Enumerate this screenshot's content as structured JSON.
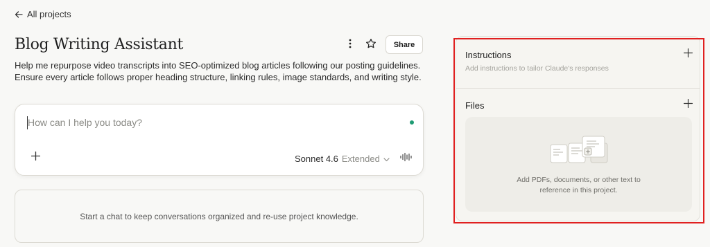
{
  "nav": {
    "back_label": "All projects"
  },
  "project": {
    "title": "Blog Writing Assistant",
    "description_line1": "Help me repurpose video transcripts into SEO-optimized blog articles following our posting guidelines.",
    "description_line2": "Ensure every article follows proper heading structure, linking rules, image standards, and writing style.",
    "share_label": "Share"
  },
  "composer": {
    "placeholder": "How can I help you today?",
    "model_name": "Sonnet 4.6",
    "model_mode": "Extended",
    "status_color": "#1e9b73"
  },
  "chats": {
    "empty_message": "Start a chat to keep conversations organized and re-use project knowledge."
  },
  "side_panel": {
    "instructions_title": "Instructions",
    "instructions_hint": "Add instructions to tailor Claude's responses",
    "files_title": "Files",
    "files_hint_line1": "Add PDFs, documents, or other text to",
    "files_hint_line2": "reference in this project.",
    "highlight_color": "#e02020"
  },
  "icons": {
    "back": "arrow-left-icon",
    "more": "more-vertical-icon",
    "star": "star-icon",
    "add": "plus-icon",
    "model_dropdown": "chevron-down-icon",
    "voice": "waveform-icon",
    "documents": "documents-illustration-icon"
  }
}
